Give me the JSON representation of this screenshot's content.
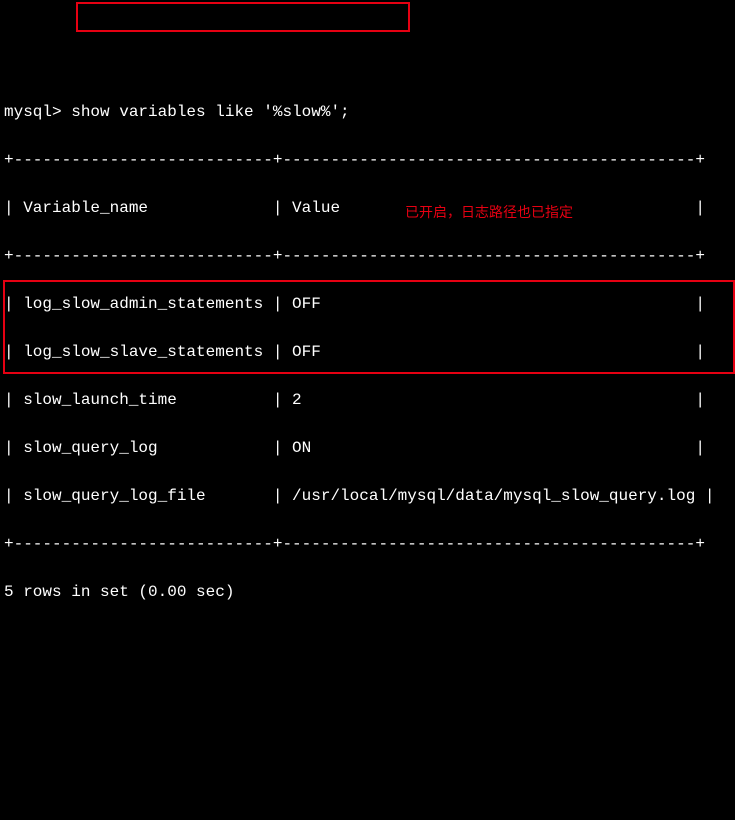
{
  "prompt": "mysql>",
  "command": " show variables like '%slow%';",
  "sep_top": "+---------------------------+-------------------------------------------+",
  "header_row": "| Variable_name             | Value                                     |",
  "sep_mid": "+---------------------------+-------------------------------------------+",
  "rows": [
    "| log_slow_admin_statements | OFF                                       |",
    "| log_slow_slave_statements | OFF                                       |",
    "| slow_launch_time          | 2                                         |",
    "| slow_query_log            | ON                                        |",
    "| slow_query_log_file       | /usr/local/mysql/data/mysql_slow_query.log |"
  ],
  "sep_bot": "+---------------------------+-------------------------------------------+",
  "footer": "5 rows in set (0.00 sec)",
  "annotation": "已开启，日志路径也已指定"
}
